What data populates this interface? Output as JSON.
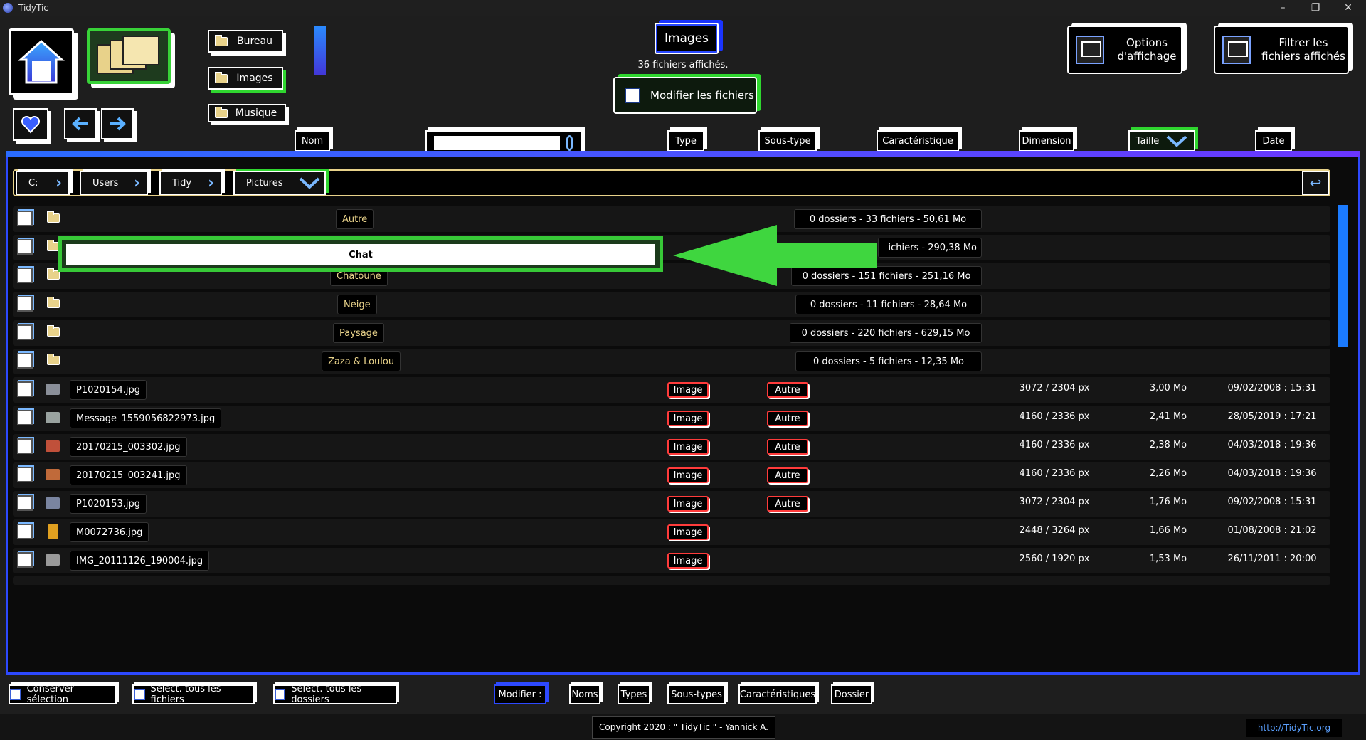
{
  "window": {
    "title": "TidyTic",
    "minimize": "–",
    "restore": "❐",
    "close": "✕"
  },
  "nav": {
    "favorites": [
      {
        "label": "Bureau"
      },
      {
        "label": "Images"
      },
      {
        "label": "Musique"
      }
    ]
  },
  "current": {
    "title": "Images",
    "count_label": "36 fichiers affichés."
  },
  "actions": {
    "modify_files": "Modifier les fichiers",
    "display_options": [
      "Options",
      "d'affichage"
    ],
    "filter_files": [
      "Filtrer les",
      "fichiers affichés"
    ]
  },
  "columns": {
    "name": "Nom",
    "type": "Type",
    "subtype": "Sous-type",
    "characteristic": "Caractéristique",
    "dimension": "Dimension",
    "size": "Taille",
    "date": "Date"
  },
  "breadcrumb": [
    "C:",
    "Users",
    "Tidy",
    "Pictures"
  ],
  "edit": {
    "value": "Chat"
  },
  "folders": [
    {
      "name": "Autre",
      "stats": "0 dossiers  -  33 fichiers  -  50,61 Mo"
    },
    {
      "name": "Chat",
      "stats": "ichiers  -  290,38 Mo"
    },
    {
      "name": "Chatoune",
      "stats": "0 dossiers  -  151 fichiers  -  251,16 Mo"
    },
    {
      "name": "Neige",
      "stats": "0 dossiers  -  11 fichiers  -  28,64 Mo"
    },
    {
      "name": "Paysage",
      "stats": "0 dossiers  -  220 fichiers  -  629,15 Mo"
    },
    {
      "name": "Zaza & Loulou",
      "stats": "0 dossiers  -  5 fichiers  -  12,35 Mo"
    }
  ],
  "files": [
    {
      "name": "P1020154.jpg",
      "type": "Image",
      "subtype": "Autre",
      "dimension": "3072 / 2304 px",
      "size": "3,00 Mo",
      "date": "09/02/2008 : 15:31",
      "thumb": "#8a8f99"
    },
    {
      "name": "Message_1559056822973.jpg",
      "type": "Image",
      "subtype": "Autre",
      "dimension": "4160 / 2336 px",
      "size": "2,41 Mo",
      "date": "28/05/2019 : 17:21",
      "thumb": "#9aa3a0"
    },
    {
      "name": "20170215_003302.jpg",
      "type": "Image",
      "subtype": "Autre",
      "dimension": "4160 / 2336 px",
      "size": "2,38 Mo",
      "date": "04/03/2018 : 19:36",
      "thumb": "#c0503a"
    },
    {
      "name": "20170215_003241.jpg",
      "type": "Image",
      "subtype": "Autre",
      "dimension": "4160 / 2336 px",
      "size": "2,26 Mo",
      "date": "04/03/2018 : 19:36",
      "thumb": "#c06a3a"
    },
    {
      "name": "P1020153.jpg",
      "type": "Image",
      "subtype": "Autre",
      "dimension": "3072 / 2304 px",
      "size": "1,76 Mo",
      "date": "09/02/2008 : 15:31",
      "thumb": "#7a85a0"
    },
    {
      "name": "M0072736.jpg",
      "type": "Image",
      "subtype": "",
      "dimension": "2448 / 3264 px",
      "size": "1,66 Mo",
      "date": "01/08/2008 : 21:02",
      "thumb": "#e0a020"
    },
    {
      "name": "IMG_20111126_190004.jpg",
      "type": "Image",
      "subtype": "",
      "dimension": "2560 / 1920 px",
      "size": "1,53 Mo",
      "date": "26/11/2011 : 20:00",
      "thumb": "#9a9a9a"
    }
  ],
  "bottom": {
    "keep_selection": "Conserver sélection",
    "select_all_files": "Select. tous les fichiers",
    "select_all_folders": "Sélect. tous les dossiers",
    "modify": "Modifier :",
    "names": "Noms",
    "types": "Types",
    "subtypes": "Sous-types",
    "characteristics": "Caractéristiques",
    "folder": "Dossier"
  },
  "footer": {
    "copyright": "Copyright 2020 : \" TidyTic \" - Yannick A.",
    "url": "http://TidyTic.org"
  },
  "colors": {
    "accent_blue": "#2d49ff",
    "accent_green": "#37c837",
    "folder_text": "#e8d28a",
    "tag_red": "#ff3b3b"
  }
}
